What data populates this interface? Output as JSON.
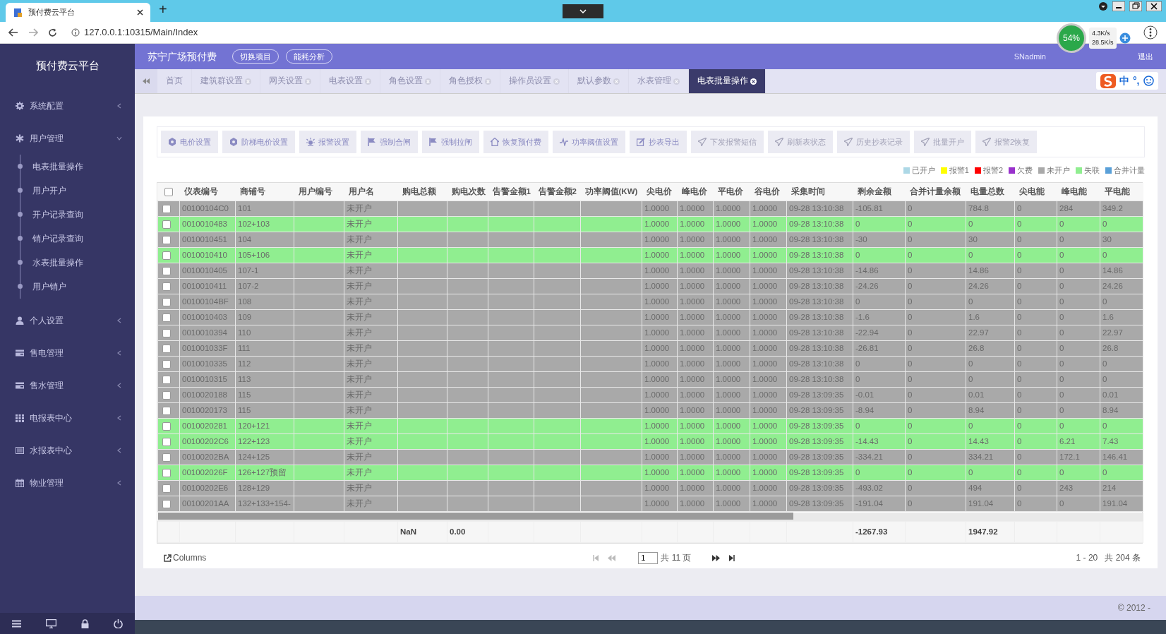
{
  "browser": {
    "tab_title": "预付费云平台",
    "new_tab": "+",
    "url": "127.0.0.1:10315/Main/Index"
  },
  "overlays": {
    "speed_percent": "54%",
    "upload": "4.3K/s",
    "download": "28.5K/s",
    "ime_mode": "中",
    "ime_punct": "°,"
  },
  "sidebar": {
    "title": "预付费云平台",
    "items": [
      {
        "label": "系统配置",
        "expanded": false
      },
      {
        "label": "用户管理",
        "expanded": true,
        "children": [
          {
            "label": "电表批量操作"
          },
          {
            "label": "用户开户"
          },
          {
            "label": "开户记录查询"
          },
          {
            "label": "销户记录查询"
          },
          {
            "label": "水表批量操作"
          },
          {
            "label": "用户销户"
          }
        ]
      },
      {
        "label": "个人设置",
        "expanded": false
      },
      {
        "label": "售电管理",
        "expanded": false
      },
      {
        "label": "售水管理",
        "expanded": false
      },
      {
        "label": "电报表中心",
        "expanded": false
      },
      {
        "label": "水报表中心",
        "expanded": false
      },
      {
        "label": "物业管理",
        "expanded": false
      }
    ]
  },
  "header": {
    "project": "苏宁广场预付费",
    "buttons": [
      "切换项目",
      "能耗分析"
    ],
    "user": "SNadmin",
    "logout": "退出"
  },
  "tabs": [
    {
      "label": "首页",
      "selected": false,
      "closable": false
    },
    {
      "label": "建筑群设置",
      "selected": false,
      "closable": true
    },
    {
      "label": "网关设置",
      "selected": false,
      "closable": true
    },
    {
      "label": "电表设置",
      "selected": false,
      "closable": true
    },
    {
      "label": "角色设置",
      "selected": false,
      "closable": true
    },
    {
      "label": "角色授权",
      "selected": false,
      "closable": true
    },
    {
      "label": "操作员设置",
      "selected": false,
      "closable": true
    },
    {
      "label": "默认参数",
      "selected": false,
      "closable": true
    },
    {
      "label": "水表管理",
      "selected": false,
      "closable": true
    },
    {
      "label": "电表批量操作",
      "selected": true,
      "closable": true
    }
  ],
  "toolbar": [
    {
      "label": "电价设置",
      "disabled": false
    },
    {
      "label": "阶梯电价设置",
      "disabled": false
    },
    {
      "label": "报警设置",
      "disabled": false
    },
    {
      "label": "强制合闸",
      "disabled": false
    },
    {
      "label": "强制拉闸",
      "disabled": false
    },
    {
      "label": "恢复预付费",
      "disabled": false
    },
    {
      "label": "功率阈值设置",
      "disabled": false
    },
    {
      "label": "抄表导出",
      "disabled": false
    },
    {
      "label": "下发报警短信",
      "disabled": true
    },
    {
      "label": "刷新表状态",
      "disabled": true
    },
    {
      "label": "历史抄表记录",
      "disabled": true
    },
    {
      "label": "批量开户",
      "disabled": true
    },
    {
      "label": "报警2恢复",
      "disabled": true
    }
  ],
  "legend": [
    {
      "label": "已开户",
      "color": "#add8e6"
    },
    {
      "label": "报警1",
      "color": "#ffff00"
    },
    {
      "label": "报警2",
      "color": "#ff0000"
    },
    {
      "label": "欠费",
      "color": "#9932cc"
    },
    {
      "label": "未开户",
      "color": "#a9a9a9"
    },
    {
      "label": "失联",
      "color": "#90ee90"
    },
    {
      "label": "合并计量",
      "color": "#5aa0d8"
    }
  ],
  "table": {
    "select_all_checked": false,
    "columns": [
      {
        "label": "仪表编号"
      },
      {
        "label": "商铺号"
      },
      {
        "label": "用户编号"
      },
      {
        "label": "用户名"
      },
      {
        "label": "购电总额",
        "total": "NaN"
      },
      {
        "label": "购电次数",
        "total": "0.00"
      },
      {
        "label": "告警金额1"
      },
      {
        "label": "告警金额2"
      },
      {
        "label": "功率阈值(KW)"
      },
      {
        "label": "尖电价"
      },
      {
        "label": "峰电价"
      },
      {
        "label": "平电价"
      },
      {
        "label": "谷电价"
      },
      {
        "label": "采集时间"
      },
      {
        "label": "剩余金额",
        "total": "-1267.93"
      },
      {
        "label": "合并计量余额"
      },
      {
        "label": "电量总数",
        "total": "1947.92"
      },
      {
        "label": "尖电能"
      },
      {
        "label": "峰电能"
      },
      {
        "label": "平电能"
      }
    ],
    "rows": [
      {
        "checked": false,
        "color": "#a9a9a9",
        "meter": "00100104C0",
        "shop": "101",
        "user_name": "未开户",
        "tip_price": "1.0000",
        "peak_price": "1.0000",
        "flat_price": "1.0000",
        "valley_price": "1.0000",
        "time": "09-28 13:10:38",
        "balance": "-105.81",
        "merged_balance": "0",
        "total_energy": "784.8",
        "tip_energy": "0",
        "peak_energy": "284",
        "flat_energy": "349.2"
      },
      {
        "checked": false,
        "color": "#90ee90",
        "meter": "0010010483",
        "shop": "102+103",
        "user_name": "未开户",
        "tip_price": "1.0000",
        "peak_price": "1.0000",
        "flat_price": "1.0000",
        "valley_price": "1.0000",
        "time": "09-28 13:10:38",
        "balance": "0",
        "merged_balance": "0",
        "total_energy": "0",
        "tip_energy": "0",
        "peak_energy": "0",
        "flat_energy": "0"
      },
      {
        "checked": false,
        "color": "#a9a9a9",
        "meter": "0010010451",
        "shop": "104",
        "user_name": "未开户",
        "tip_price": "1.0000",
        "peak_price": "1.0000",
        "flat_price": "1.0000",
        "valley_price": "1.0000",
        "time": "09-28 13:10:38",
        "balance": "-30",
        "merged_balance": "0",
        "total_energy": "30",
        "tip_energy": "0",
        "peak_energy": "0",
        "flat_energy": "30"
      },
      {
        "checked": false,
        "color": "#90ee90",
        "meter": "0010010410",
        "shop": "105+106",
        "user_name": "未开户",
        "tip_price": "1.0000",
        "peak_price": "1.0000",
        "flat_price": "1.0000",
        "valley_price": "1.0000",
        "time": "09-28 13:10:38",
        "balance": "0",
        "merged_balance": "0",
        "total_energy": "0",
        "tip_energy": "0",
        "peak_energy": "0",
        "flat_energy": "0"
      },
      {
        "checked": false,
        "color": "#a9a9a9",
        "meter": "0010010405",
        "shop": "107-1",
        "user_name": "未开户",
        "tip_price": "1.0000",
        "peak_price": "1.0000",
        "flat_price": "1.0000",
        "valley_price": "1.0000",
        "time": "09-28 13:10:38",
        "balance": "-14.86",
        "merged_balance": "0",
        "total_energy": "14.86",
        "tip_energy": "0",
        "peak_energy": "0",
        "flat_energy": "14.86"
      },
      {
        "checked": false,
        "color": "#a9a9a9",
        "meter": "0010010411",
        "shop": "107-2",
        "user_name": "未开户",
        "tip_price": "1.0000",
        "peak_price": "1.0000",
        "flat_price": "1.0000",
        "valley_price": "1.0000",
        "time": "09-28 13:10:38",
        "balance": "-24.26",
        "merged_balance": "0",
        "total_energy": "24.26",
        "tip_energy": "0",
        "peak_energy": "0",
        "flat_energy": "24.26"
      },
      {
        "checked": false,
        "color": "#a9a9a9",
        "meter": "00100104BF",
        "shop": "108",
        "user_name": "未开户",
        "tip_price": "1.0000",
        "peak_price": "1.0000",
        "flat_price": "1.0000",
        "valley_price": "1.0000",
        "time": "09-28 13:10:38",
        "balance": "0",
        "merged_balance": "0",
        "total_energy": "0",
        "tip_energy": "0",
        "peak_energy": "0",
        "flat_energy": "0"
      },
      {
        "checked": false,
        "color": "#a9a9a9",
        "meter": "0010010403",
        "shop": "109",
        "user_name": "未开户",
        "tip_price": "1.0000",
        "peak_price": "1.0000",
        "flat_price": "1.0000",
        "valley_price": "1.0000",
        "time": "09-28 13:10:38",
        "balance": "-1.6",
        "merged_balance": "0",
        "total_energy": "1.6",
        "tip_energy": "0",
        "peak_energy": "0",
        "flat_energy": "1.6"
      },
      {
        "checked": false,
        "color": "#a9a9a9",
        "meter": "0010010394",
        "shop": "110",
        "user_name": "未开户",
        "tip_price": "1.0000",
        "peak_price": "1.0000",
        "flat_price": "1.0000",
        "valley_price": "1.0000",
        "time": "09-28 13:10:38",
        "balance": "-22.94",
        "merged_balance": "0",
        "total_energy": "22.97",
        "tip_energy": "0",
        "peak_energy": "0",
        "flat_energy": "22.97"
      },
      {
        "checked": false,
        "color": "#a9a9a9",
        "meter": "001001033F",
        "shop": "111",
        "user_name": "未开户",
        "tip_price": "1.0000",
        "peak_price": "1.0000",
        "flat_price": "1.0000",
        "valley_price": "1.0000",
        "time": "09-28 13:10:38",
        "balance": "-26.81",
        "merged_balance": "0",
        "total_energy": "26.8",
        "tip_energy": "0",
        "peak_energy": "0",
        "flat_energy": "26.8"
      },
      {
        "checked": false,
        "color": "#a9a9a9",
        "meter": "0010010335",
        "shop": "112",
        "user_name": "未开户",
        "tip_price": "1.0000",
        "peak_price": "1.0000",
        "flat_price": "1.0000",
        "valley_price": "1.0000",
        "time": "09-28 13:10:38",
        "balance": "0",
        "merged_balance": "0",
        "total_energy": "0",
        "tip_energy": "0",
        "peak_energy": "0",
        "flat_energy": "0"
      },
      {
        "checked": false,
        "color": "#a9a9a9",
        "meter": "0010010315",
        "shop": "113",
        "user_name": "未开户",
        "tip_price": "1.0000",
        "peak_price": "1.0000",
        "flat_price": "1.0000",
        "valley_price": "1.0000",
        "time": "09-28 13:10:38",
        "balance": "0",
        "merged_balance": "0",
        "total_energy": "0",
        "tip_energy": "0",
        "peak_energy": "0",
        "flat_energy": "0"
      },
      {
        "checked": false,
        "color": "#a9a9a9",
        "meter": "0010020188",
        "shop": "115",
        "user_name": "未开户",
        "tip_price": "1.0000",
        "peak_price": "1.0000",
        "flat_price": "1.0000",
        "valley_price": "1.0000",
        "time": "09-28 13:09:35",
        "balance": "-0.01",
        "merged_balance": "0",
        "total_energy": "0.01",
        "tip_energy": "0",
        "peak_energy": "0",
        "flat_energy": "0.01"
      },
      {
        "checked": false,
        "color": "#a9a9a9",
        "meter": "0010020173",
        "shop": "115",
        "user_name": "未开户",
        "tip_price": "1.0000",
        "peak_price": "1.0000",
        "flat_price": "1.0000",
        "valley_price": "1.0000",
        "time": "09-28 13:09:35",
        "balance": "-8.94",
        "merged_balance": "0",
        "total_energy": "8.94",
        "tip_energy": "0",
        "peak_energy": "0",
        "flat_energy": "8.94"
      },
      {
        "checked": false,
        "color": "#90ee90",
        "meter": "0010020281",
        "shop": "120+121",
        "user_name": "未开户",
        "tip_price": "1.0000",
        "peak_price": "1.0000",
        "flat_price": "1.0000",
        "valley_price": "1.0000",
        "time": "09-28 13:09:35",
        "balance": "0",
        "merged_balance": "0",
        "total_energy": "0",
        "tip_energy": "0",
        "peak_energy": "0",
        "flat_energy": "0"
      },
      {
        "checked": false,
        "color": "#90ee90",
        "meter": "00100202C6",
        "shop": "122+123",
        "user_name": "未开户",
        "tip_price": "1.0000",
        "peak_price": "1.0000",
        "flat_price": "1.0000",
        "valley_price": "1.0000",
        "time": "09-28 13:09:35",
        "balance": "-14.43",
        "merged_balance": "0",
        "total_energy": "14.43",
        "tip_energy": "0",
        "peak_energy": "6.21",
        "flat_energy": "7.43"
      },
      {
        "checked": false,
        "color": "#a9a9a9",
        "meter": "00100202BA",
        "shop": "124+125",
        "user_name": "未开户",
        "tip_price": "1.0000",
        "peak_price": "1.0000",
        "flat_price": "1.0000",
        "valley_price": "1.0000",
        "time": "09-28 13:09:35",
        "balance": "-334.21",
        "merged_balance": "0",
        "total_energy": "334.21",
        "tip_energy": "0",
        "peak_energy": "172.1",
        "flat_energy": "146.41"
      },
      {
        "checked": false,
        "color": "#90ee90",
        "meter": "001002026F",
        "shop": "126+127预留",
        "user_name": "未开户",
        "tip_price": "1.0000",
        "peak_price": "1.0000",
        "flat_price": "1.0000",
        "valley_price": "1.0000",
        "time": "09-28 13:09:35",
        "balance": "0",
        "merged_balance": "0",
        "total_energy": "0",
        "tip_energy": "0",
        "peak_energy": "0",
        "flat_energy": "0"
      },
      {
        "checked": false,
        "color": "#a9a9a9",
        "meter": "00100202E6",
        "shop": "128+129",
        "user_name": "未开户",
        "tip_price": "1.0000",
        "peak_price": "1.0000",
        "flat_price": "1.0000",
        "valley_price": "1.0000",
        "time": "09-28 13:09:35",
        "balance": "-493.02",
        "merged_balance": "0",
        "total_energy": "494",
        "tip_energy": "0",
        "peak_energy": "243",
        "flat_energy": "214"
      },
      {
        "checked": false,
        "color": "#a9a9a9",
        "meter": "00100201AA",
        "shop": "132+133+154-",
        "user_name": "未开户",
        "tip_price": "1.0000",
        "peak_price": "1.0000",
        "flat_price": "1.0000",
        "valley_price": "1.0000",
        "time": "09-28 13:09:35",
        "balance": "-191.04",
        "merged_balance": "0",
        "total_energy": "191.04",
        "tip_energy": "0",
        "peak_energy": "0",
        "flat_energy": "191.04"
      }
    ]
  },
  "pagination": {
    "columns_button": "Columns",
    "page": "1",
    "page_count": "共 11 页",
    "range": "1 - 20",
    "total": "共 204 条"
  },
  "footer": "© 2012 -"
}
